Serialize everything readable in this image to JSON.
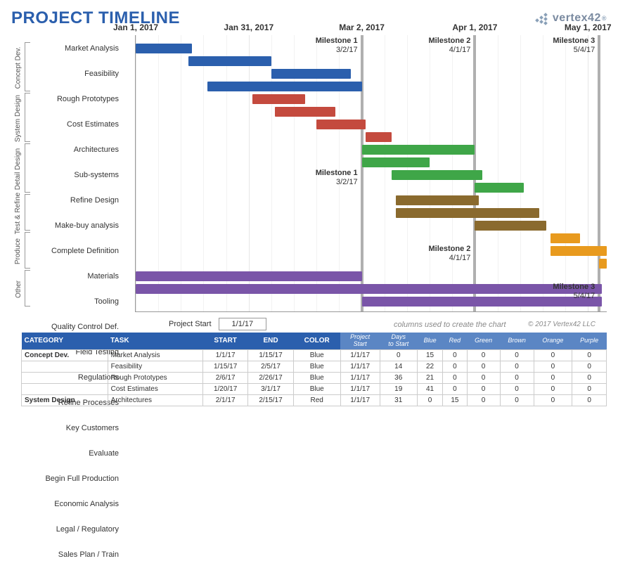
{
  "title": "PROJECT TIMELINE",
  "brand": "vertex42",
  "project_start_label": "Project Start",
  "project_start_value": "1/1/17",
  "columns_note": "columns used to create the chart",
  "copyright": "© 2017 Vertex42 LLC",
  "chart_data": {
    "type": "bar",
    "orientation": "horizontal-gantt",
    "x_axis": {
      "ticks": [
        "Jan 1, 2017",
        "Jan 31, 2017",
        "Mar 2, 2017",
        "Apr 1, 2017",
        "May 1, 2017"
      ],
      "tick_positions_pct": [
        0,
        24,
        48,
        72,
        96
      ]
    },
    "milestones": [
      {
        "name": "Milestone 1",
        "date": "3/2/17",
        "pos_pct": 48,
        "label_top": true
      },
      {
        "name": "Milestone 2",
        "date": "4/1/17",
        "pos_pct": 72,
        "label_top": true
      },
      {
        "name": "Milestone 3",
        "date": "5/4/17",
        "pos_pct": 98.4,
        "label_top": true
      },
      {
        "name": "Milestone 1",
        "date": "3/2/17",
        "pos_pct": 48,
        "label_top": false,
        "row": 10
      },
      {
        "name": "Milestone 2",
        "date": "4/1/17",
        "pos_pct": 72,
        "label_top": false,
        "row": 16
      },
      {
        "name": "Milestone 3",
        "date": "5/4/17",
        "pos_pct": 98.4,
        "label_top": false,
        "row": 19
      }
    ],
    "categories": [
      {
        "name": "Concept Dev.",
        "rows": [
          0,
          3
        ]
      },
      {
        "name": "System Design",
        "rows": [
          4,
          7
        ]
      },
      {
        "name": "Detail Design",
        "rows": [
          8,
          11
        ]
      },
      {
        "name": "Test & Refine",
        "rows": [
          12,
          14
        ]
      },
      {
        "name": "Produce",
        "rows": [
          15,
          17
        ]
      },
      {
        "name": "Other",
        "rows": [
          18,
          20
        ]
      }
    ],
    "tasks": [
      {
        "label": "Market Analysis",
        "start_pct": 0,
        "dur_pct": 12,
        "color": "blue"
      },
      {
        "label": "Feasibility",
        "start_pct": 11.2,
        "dur_pct": 17.6,
        "color": "blue"
      },
      {
        "label": "Rough Prototypes",
        "start_pct": 28.8,
        "dur_pct": 16.8,
        "color": "blue"
      },
      {
        "label": "Cost Estimates",
        "start_pct": 15.2,
        "dur_pct": 32.8,
        "color": "blue"
      },
      {
        "label": "Architectures",
        "start_pct": 24.8,
        "dur_pct": 11.2,
        "color": "red"
      },
      {
        "label": "Sub-systems",
        "start_pct": 29.6,
        "dur_pct": 12.8,
        "color": "red"
      },
      {
        "label": "Refine Design",
        "start_pct": 38.4,
        "dur_pct": 10.4,
        "color": "red"
      },
      {
        "label": "Make-buy analysis",
        "start_pct": 48.8,
        "dur_pct": 5.6,
        "color": "red"
      },
      {
        "label": "Complete Definition",
        "start_pct": 48,
        "dur_pct": 24,
        "color": "green"
      },
      {
        "label": "Materials",
        "start_pct": 48,
        "dur_pct": 14.4,
        "color": "green"
      },
      {
        "label": "Tooling",
        "start_pct": 54.4,
        "dur_pct": 19.2,
        "color": "green"
      },
      {
        "label": "Quality Control Def.",
        "start_pct": 72,
        "dur_pct": 10.4,
        "color": "green"
      },
      {
        "label": "Field Testing",
        "start_pct": 55.2,
        "dur_pct": 17.6,
        "color": "brown"
      },
      {
        "label": "Regulations",
        "start_pct": 55.2,
        "dur_pct": 30.4,
        "color": "brown"
      },
      {
        "label": "Refine Processes",
        "start_pct": 72,
        "dur_pct": 15.2,
        "color": "brown"
      },
      {
        "label": "Key Customers",
        "start_pct": 88,
        "dur_pct": 6.4,
        "color": "orange"
      },
      {
        "label": "Evaluate",
        "start_pct": 88,
        "dur_pct": 12,
        "color": "orange"
      },
      {
        "label": "Begin Full Production",
        "start_pct": 98.4,
        "dur_pct": 1.6,
        "color": "orange"
      },
      {
        "label": "Economic Analysis",
        "start_pct": 0,
        "dur_pct": 48,
        "color": "purple"
      },
      {
        "label": "Legal / Regulatory",
        "start_pct": 0,
        "dur_pct": 99,
        "color": "purple"
      },
      {
        "label": "Sales Plan / Train",
        "start_pct": 48,
        "dur_pct": 51,
        "color": "purple"
      }
    ]
  },
  "table": {
    "headers_main": [
      "CATEGORY",
      "TASK",
      "START",
      "END",
      "COLOR"
    ],
    "headers_calc": [
      "Project Start",
      "Days to Start",
      "Blue",
      "Red",
      "Green",
      "Brown",
      "Orange",
      "Purple"
    ],
    "rows": [
      {
        "category": "Concept Dev.",
        "task": "Market Analysis",
        "start": "1/1/17",
        "end": "1/15/17",
        "color": "Blue",
        "ps": "1/1/17",
        "dts": "0",
        "vals": [
          "15",
          "0",
          "0",
          "0",
          "0",
          "0"
        ]
      },
      {
        "category": "",
        "task": "Feasibility",
        "start": "1/15/17",
        "end": "2/5/17",
        "color": "Blue",
        "ps": "1/1/17",
        "dts": "14",
        "vals": [
          "22",
          "0",
          "0",
          "0",
          "0",
          "0"
        ]
      },
      {
        "category": "",
        "task": "Rough Prototypes",
        "start": "2/6/17",
        "end": "2/26/17",
        "color": "Blue",
        "ps": "1/1/17",
        "dts": "36",
        "vals": [
          "21",
          "0",
          "0",
          "0",
          "0",
          "0"
        ]
      },
      {
        "category": "",
        "task": "Cost Estimates",
        "start": "1/20/17",
        "end": "3/1/17",
        "color": "Blue",
        "ps": "1/1/17",
        "dts": "19",
        "vals": [
          "41",
          "0",
          "0",
          "0",
          "0",
          "0"
        ]
      },
      {
        "category": "System Design",
        "task": "Architectures",
        "start": "2/1/17",
        "end": "2/15/17",
        "color": "Red",
        "ps": "1/1/17",
        "dts": "31",
        "vals": [
          "0",
          "15",
          "0",
          "0",
          "0",
          "0"
        ]
      }
    ]
  }
}
